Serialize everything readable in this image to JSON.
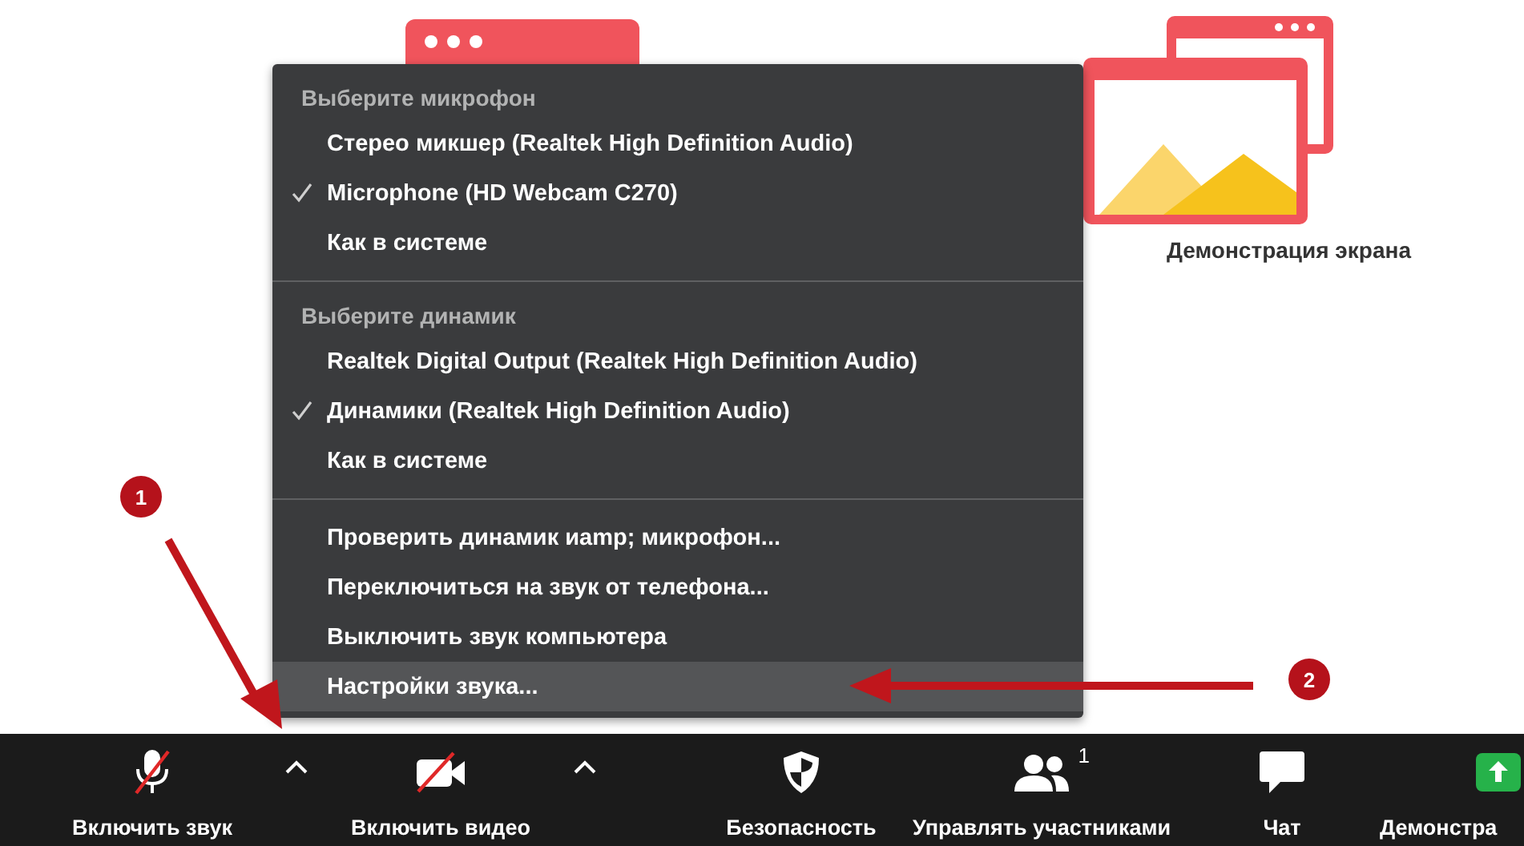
{
  "background": {
    "share_screen_label": "Демонстрация экрана"
  },
  "audio_menu": {
    "sections": [
      {
        "header": "Выберите микрофон",
        "items": [
          {
            "label": "Стерео микшер (Realtek High Definition Audio)",
            "checked": false,
            "selected": false
          },
          {
            "label": "Microphone (HD Webcam C270)",
            "checked": true,
            "selected": false
          },
          {
            "label": "Как в системе",
            "checked": false,
            "selected": false
          }
        ]
      },
      {
        "header": "Выберите динамик",
        "items": [
          {
            "label": "Realtek Digital Output (Realtek High Definition Audio)",
            "checked": false,
            "selected": false
          },
          {
            "label": "Динамики (Realtek High Definition Audio)",
            "checked": true,
            "selected": false
          },
          {
            "label": "Как в системе",
            "checked": false,
            "selected": false
          }
        ]
      },
      {
        "items": [
          {
            "label": "Проверить динамик иamp; микрофон...",
            "checked": false,
            "selected": false
          },
          {
            "label": "Переключиться на звук от телефона...",
            "checked": false,
            "selected": false
          },
          {
            "label": "Выключить звук компьютера",
            "checked": false,
            "selected": false
          },
          {
            "label": "Настройки звука...",
            "checked": false,
            "selected": true
          }
        ]
      }
    ]
  },
  "toolbar": [
    {
      "kind": "mic",
      "label": "Включить звук",
      "muted": true
    },
    {
      "kind": "caret"
    },
    {
      "kind": "video",
      "label": "Включить видео",
      "muted": true
    },
    {
      "kind": "caret"
    },
    {
      "kind": "spacer"
    },
    {
      "kind": "security",
      "label": "Безопасность"
    },
    {
      "kind": "participants",
      "label": "Управлять участниками",
      "count": "1"
    },
    {
      "kind": "chat",
      "label": "Чат"
    },
    {
      "kind": "share",
      "label": "Демонстра"
    }
  ],
  "annotations": [
    {
      "number": "1"
    },
    {
      "number": "2"
    }
  ]
}
